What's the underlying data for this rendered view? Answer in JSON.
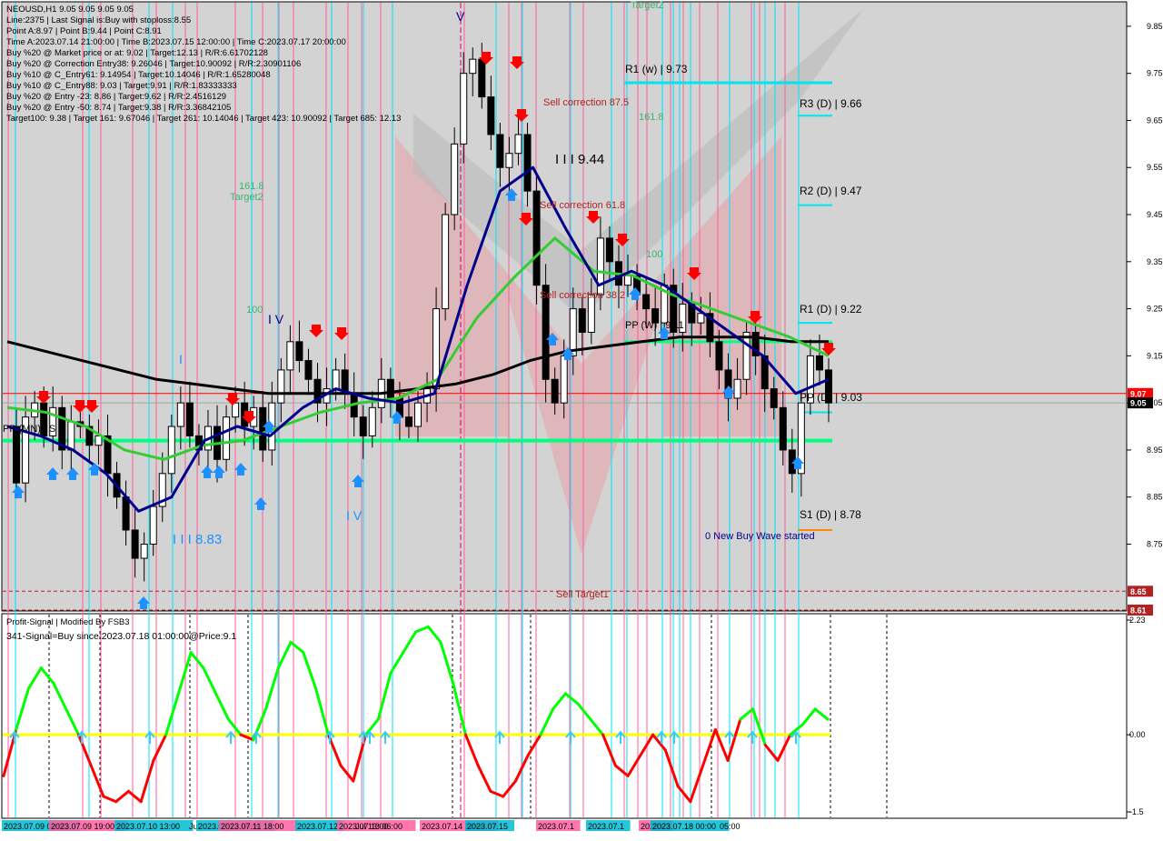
{
  "colors": {
    "bg": "#ffffff",
    "plot_bg": "#d3d3d3",
    "vline_pink": "#ff5fa0",
    "vline_cyan": "#00e5ff",
    "ma_black": "#000000",
    "ma_blue": "#00008b",
    "ma_green": "#32cd32",
    "level_green": "#00ff7f",
    "level_cyan": "#00e5ee",
    "price_red": "#ff0000",
    "price_bid": "#000000",
    "osc_green": "#00ff00",
    "osc_red": "#ff0000",
    "osc_zero": "#ffff00",
    "watermark": "#e8a0a8"
  },
  "header": {
    "title": "NEOUSD,H1  9.05 9.05 9.05 9.05",
    "lines": [
      "Line:2375  | Last Signal is:Buy with stoploss:8.55",
      "Point A:8.97  | Point B:9.44  | Point C:8.91",
      "Time A:2023.07.14 21:00:00  | Time B:2023.07.15 12:00:00  | Time C:2023.07.17 20:00:00",
      "Buy %20 @ Market price or at: 9.02  | Target:12.13  | R/R:6.61702128",
      "Buy %20 @ Correction Entry38: 9.26046  | Target:10.90092  | R/R:2.30901106",
      "Buy %10 @ C_Entry61: 9.14954  | Target:10.14046  | R/R:1.65280048",
      "Buy %10 @ C_Entry88: 9.03  | Target:9.91  | R/R:1.83333333",
      "Buy %20 @ Entry -23: 8.86  | Target:9.62  | R/R:2.4516129",
      "Buy %20 @ Entry -50: 8.74  | Target:9.38  | R/R:3.36842105",
      "Target100: 9.38  | Target 161: 9.67046  | Target 261: 10.14046  | Target 423: 10.90092  | Target 685: 12.13"
    ]
  },
  "price_axis": {
    "ticks": [
      "9.85",
      "9.75",
      "9.65",
      "9.55",
      "9.45",
      "9.35",
      "9.25",
      "9.15",
      "9.05",
      "8.95",
      "8.85",
      "8.75"
    ],
    "tick_values": [
      9.85,
      9.75,
      9.65,
      9.55,
      9.45,
      9.35,
      9.25,
      9.15,
      9.05,
      8.95,
      8.85,
      8.75
    ],
    "label_red_top": "9.07",
    "label_bid": "9.05",
    "label_865": "8.65",
    "label_861": "8.61"
  },
  "osc_axis": {
    "ticks": [
      "2.23",
      "0.00",
      "-1.5"
    ],
    "tick_values": [
      2.23,
      0.0,
      -1.5
    ]
  },
  "time_axis": [
    "2023.07.09 00:00",
    "2023.07.09 19:00",
    "2023.07.10 13:00",
    "Jul",
    "2023.07.11 08:00",
    "2023.07.11 18:00",
    "2023.07.12",
    "2023.07.13 06:00",
    "Jul 13:00",
    "2023.07.14 14:00",
    "2023.07.15",
    "2023.07.1",
    "2023.07.1",
    "2023.07",
    "2023.07.18 00:00",
    "05:00"
  ],
  "annotations": {
    "target2_top": "Target2",
    "r1w": "R1 (w) | 9.73",
    "r3d": "R3 (D) | 9.66",
    "r2d": "R2 (D) | 9.47",
    "r1d": "R1 (D) | 9.22",
    "ppd": "PP (D) | 9.03",
    "s1d": "S1 (D) | 8.78",
    "sell_corr_875": "Sell correction 87.5",
    "sell_corr_618": "Sell correction 61.8",
    "sell_corr_382": "Sell correction 38.2",
    "fib_1618_right": "161.8",
    "fib_100_right": "100",
    "wave_iii_944": "I I I 9.44",
    "fib_1618_left": "161.8",
    "target2_left": "Target2",
    "fib_100_left": "100",
    "wave_iv_top": "I V",
    "wave_i": "I",
    "wave_iii_883": "I I I 8.83",
    "wave_iv_bottom": "I V",
    "wave_v": "V",
    "pp_left": "PP (MN) | S",
    "pp_mid": "PP (W) | 9.11",
    "new_buy_wave": "0 New Buy Wave started",
    "sell_target1": "Sell Target1"
  },
  "indicator": {
    "title": "Profit-Signal | Modified By FSB3",
    "signal": "341-Signal=Buy since:2023.07.18 01:00:00@Price:9.1"
  },
  "chart_data": [
    {
      "type": "candlestick",
      "title": "NEOUSD,H1",
      "ylim": [
        8.61,
        9.9
      ],
      "last_price": 9.05,
      "levels": [
        {
          "name": "R1 (w)",
          "value": 9.73
        },
        {
          "name": "R3 (D)",
          "value": 9.66
        },
        {
          "name": "R2 (D)",
          "value": 9.47
        },
        {
          "name": "R1 (D)",
          "value": 9.22
        },
        {
          "name": "PP (D)",
          "value": 9.03
        },
        {
          "name": "S1 (D)",
          "value": 8.78
        },
        {
          "name": "",
          "value": 8.97
        },
        {
          "name": "",
          "value": 9.18
        },
        {
          "name": "",
          "value": 9.07
        },
        {
          "name": "",
          "value": 8.65
        },
        {
          "name": "",
          "value": 8.61
        }
      ],
      "price_path": [
        9.0,
        8.88,
        9.02,
        9.05,
        8.98,
        9.04,
        8.95,
        9.01,
        9.0,
        8.96,
        8.98,
        8.9,
        8.85,
        8.78,
        8.72,
        8.75,
        8.83,
        8.9,
        9.0,
        9.05,
        8.98,
        8.95,
        9.0,
        8.93,
        9.02,
        9.05,
        9.0,
        9.04,
        8.95,
        9.05,
        9.12,
        9.18,
        9.14,
        9.1,
        9.05,
        9.08,
        9.12,
        9.07,
        9.02,
        8.98,
        9.04,
        9.1,
        9.06,
        9.02,
        9.0,
        9.05,
        9.08,
        9.25,
        9.45,
        9.6,
        9.75,
        9.78,
        9.7,
        9.62,
        9.55,
        9.58,
        9.62,
        9.5,
        9.3,
        9.1,
        9.05,
        9.15,
        9.25,
        9.2,
        9.28,
        9.4,
        9.35,
        9.3,
        9.32,
        9.28,
        9.25,
        9.22,
        9.3,
        9.2,
        9.26,
        9.22,
        9.24,
        9.18,
        9.12,
        9.06,
        9.1,
        9.2,
        9.15,
        9.08,
        9.04,
        8.95,
        8.9,
        9.05,
        9.15,
        9.12,
        9.05
      ],
      "ma_black": [
        9.18,
        9.16,
        9.14,
        9.12,
        9.1,
        9.09,
        9.08,
        9.07,
        9.07,
        9.07,
        9.07,
        9.08,
        9.09,
        9.11,
        9.14,
        9.16,
        9.17,
        9.18,
        9.19,
        9.19,
        9.19,
        9.18,
        9.18
      ],
      "ma_blue": [
        9.0,
        8.98,
        8.95,
        8.9,
        8.82,
        8.85,
        8.97,
        9.0,
        8.98,
        9.04,
        9.08,
        9.06,
        9.05,
        9.07,
        9.3,
        9.5,
        9.55,
        9.42,
        9.3,
        9.33,
        9.3,
        9.25,
        9.2,
        9.15,
        9.07,
        9.1
      ],
      "ma_green": [
        9.04,
        9.03,
        9.0,
        8.95,
        8.93,
        8.96,
        8.97,
        9.0,
        9.03,
        9.05,
        9.06,
        9.1,
        9.23,
        9.32,
        9.4,
        9.33,
        9.32,
        9.28,
        9.25,
        9.22,
        9.19,
        9.15
      ]
    },
    {
      "type": "line",
      "title": "Profit-Signal | Modified By FSB3",
      "ylim": [
        -1.5,
        2.23
      ],
      "values": [
        -0.8,
        0.1,
        0.9,
        1.3,
        1.0,
        0.5,
        0.0,
        -0.6,
        -1.2,
        -1.3,
        -1.1,
        -1.3,
        -0.5,
        0.0,
        0.8,
        1.6,
        1.3,
        0.8,
        0.3,
        0.0,
        -0.1,
        0.5,
        1.3,
        1.8,
        1.6,
        0.9,
        0.0,
        -0.6,
        -0.9,
        0.0,
        0.3,
        1.2,
        1.6,
        2.0,
        2.1,
        1.8,
        1.0,
        0.0,
        -0.6,
        -1.1,
        -1.2,
        -0.9,
        -0.4,
        0.0,
        0.5,
        0.8,
        0.6,
        0.3,
        0.0,
        -0.6,
        -0.8,
        -0.4,
        0.0,
        -0.3,
        -1.0,
        -1.3,
        -0.6,
        0.1,
        -0.5,
        0.3,
        0.5,
        -0.2,
        -0.5,
        0.0,
        0.2,
        0.5,
        0.3
      ]
    }
  ]
}
